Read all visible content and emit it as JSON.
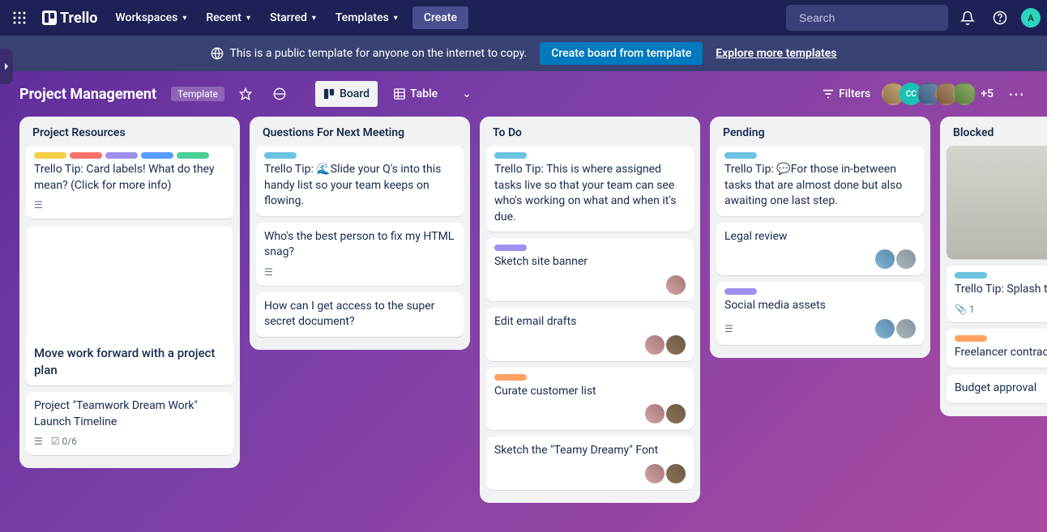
{
  "nav": {
    "brand": "Trello",
    "items": [
      "Workspaces",
      "Recent",
      "Starred",
      "Templates"
    ],
    "create": "Create",
    "search_placeholder": "Search",
    "avatar_initial": "A"
  },
  "banner": {
    "message": "This is a public template for anyone on the internet to copy.",
    "cta": "Create board from template",
    "link": "Explore more templates"
  },
  "board_header": {
    "title": "Project Management",
    "template_badge": "Template",
    "view_board": "Board",
    "view_table": "Table",
    "filters": "Filters",
    "member_overflow": "+5",
    "member_initials": "CC"
  },
  "lists": [
    {
      "title": "Project Resources",
      "cards": [
        {
          "labels": [
            "yellow",
            "red",
            "purple",
            "blue",
            "green"
          ],
          "text": "Trello Tip: Card labels! What do they mean? (Click for more info)",
          "desc": true
        },
        {
          "cover": true,
          "title": "Move work forward with a project plan"
        },
        {
          "text": "Project \"Teamwork Dream Work\" Launch Timeline",
          "desc": true,
          "checklist": "0/6"
        }
      ]
    },
    {
      "title": "Questions For Next Meeting",
      "cards": [
        {
          "labels": [
            "sky"
          ],
          "text": "Trello Tip: 🌊Slide your Q's into this handy list so your team keeps on flowing."
        },
        {
          "text": "Who's the best person to fix my HTML snag?",
          "desc": true
        },
        {
          "text": "How can I get access to the super secret document?"
        }
      ]
    },
    {
      "title": "To Do",
      "cards": [
        {
          "labels": [
            "sky"
          ],
          "text": "Trello Tip: This is where assigned tasks live so that your team can see who's working on what and when it's due."
        },
        {
          "labels": [
            "purple"
          ],
          "text": "Sketch site banner",
          "members": 1
        },
        {
          "text": "Edit email drafts",
          "members": 2
        },
        {
          "labels": [
            "orange"
          ],
          "text": "Curate customer list",
          "members": 2
        },
        {
          "text": "Sketch the \"Teamy Dreamy\" Font",
          "members": 2
        }
      ]
    },
    {
      "title": "Pending",
      "cards": [
        {
          "labels": [
            "sky"
          ],
          "text": "Trello Tip: 💬For those in-between tasks that are almost done but also awaiting one last step."
        },
        {
          "text": "Legal review",
          "members": 2
        },
        {
          "labels": [
            "purple"
          ],
          "text": "Social media assets",
          "desc": true,
          "members": 2
        }
      ]
    },
    {
      "title": "Blocked",
      "cards": [
        {
          "cover_photo": true
        },
        {
          "labels": [
            "sky"
          ],
          "text": "Trello Tip: Splash those redtape-heavy issues that are slowing your team down here.",
          "attachment": "1"
        },
        {
          "labels": [
            "orange"
          ],
          "text": "Freelancer contracts"
        },
        {
          "text": "Budget approval"
        }
      ]
    }
  ]
}
